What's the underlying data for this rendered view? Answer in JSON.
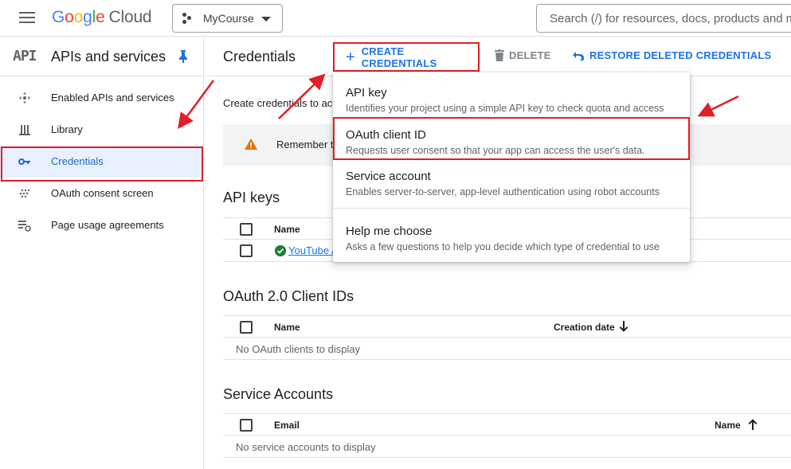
{
  "topbar": {
    "logo_letters": [
      "G",
      "o",
      "o",
      "g",
      "l",
      "e"
    ],
    "logo_suffix": "Cloud",
    "project_name": "MyCourse",
    "search_placeholder": "Search (/) for resources, docs, products and m"
  },
  "sidebar": {
    "icon_text": "API",
    "title": "APIs and services",
    "items": [
      {
        "label": "Enabled APIs and services",
        "icon": "hub-icon"
      },
      {
        "label": "Library",
        "icon": "library-icon"
      },
      {
        "label": "Credentials",
        "icon": "key-icon",
        "active": true
      },
      {
        "label": "OAuth consent screen",
        "icon": "consent-icon"
      },
      {
        "label": "Page usage agreements",
        "icon": "settings-list-icon"
      }
    ]
  },
  "header": {
    "title": "Credentials",
    "create_label": "CREATE CREDENTIALS",
    "delete_label": "DELETE",
    "restore_label": "RESTORE DELETED CREDENTIALS"
  },
  "main": {
    "intro_text": "Create credentials to acc",
    "banner_text": "Remember t",
    "api_keys": {
      "title": "API keys",
      "col_name": "Name",
      "rows": [
        {
          "name": "YouTube A"
        }
      ]
    },
    "oauth": {
      "title": "OAuth 2.0 Client IDs",
      "col_name": "Name",
      "col_date": "Creation date",
      "empty_text": "No OAuth clients to display"
    },
    "service_accounts": {
      "title": "Service Accounts",
      "col_email": "Email",
      "col_name": "Name",
      "empty_text": "No service accounts to display"
    }
  },
  "menu": {
    "items": [
      {
        "title": "API key",
        "desc": "Identifies your project using a simple API key to check quota and access"
      },
      {
        "title": "OAuth client ID",
        "desc": "Requests user consent so that your app can access the user's data."
      },
      {
        "title": "Service account",
        "desc": "Enables server-to-server, app-level authentication using robot accounts"
      },
      {
        "title": "Help me choose",
        "desc": "Asks a few questions to help you decide which type of credential to use"
      }
    ]
  },
  "colors": {
    "accent": "#1a73e8",
    "annotation_red": "#e01f26",
    "active_bg": "#e8f0fe",
    "warning": "#e37400",
    "success": "#188038"
  }
}
